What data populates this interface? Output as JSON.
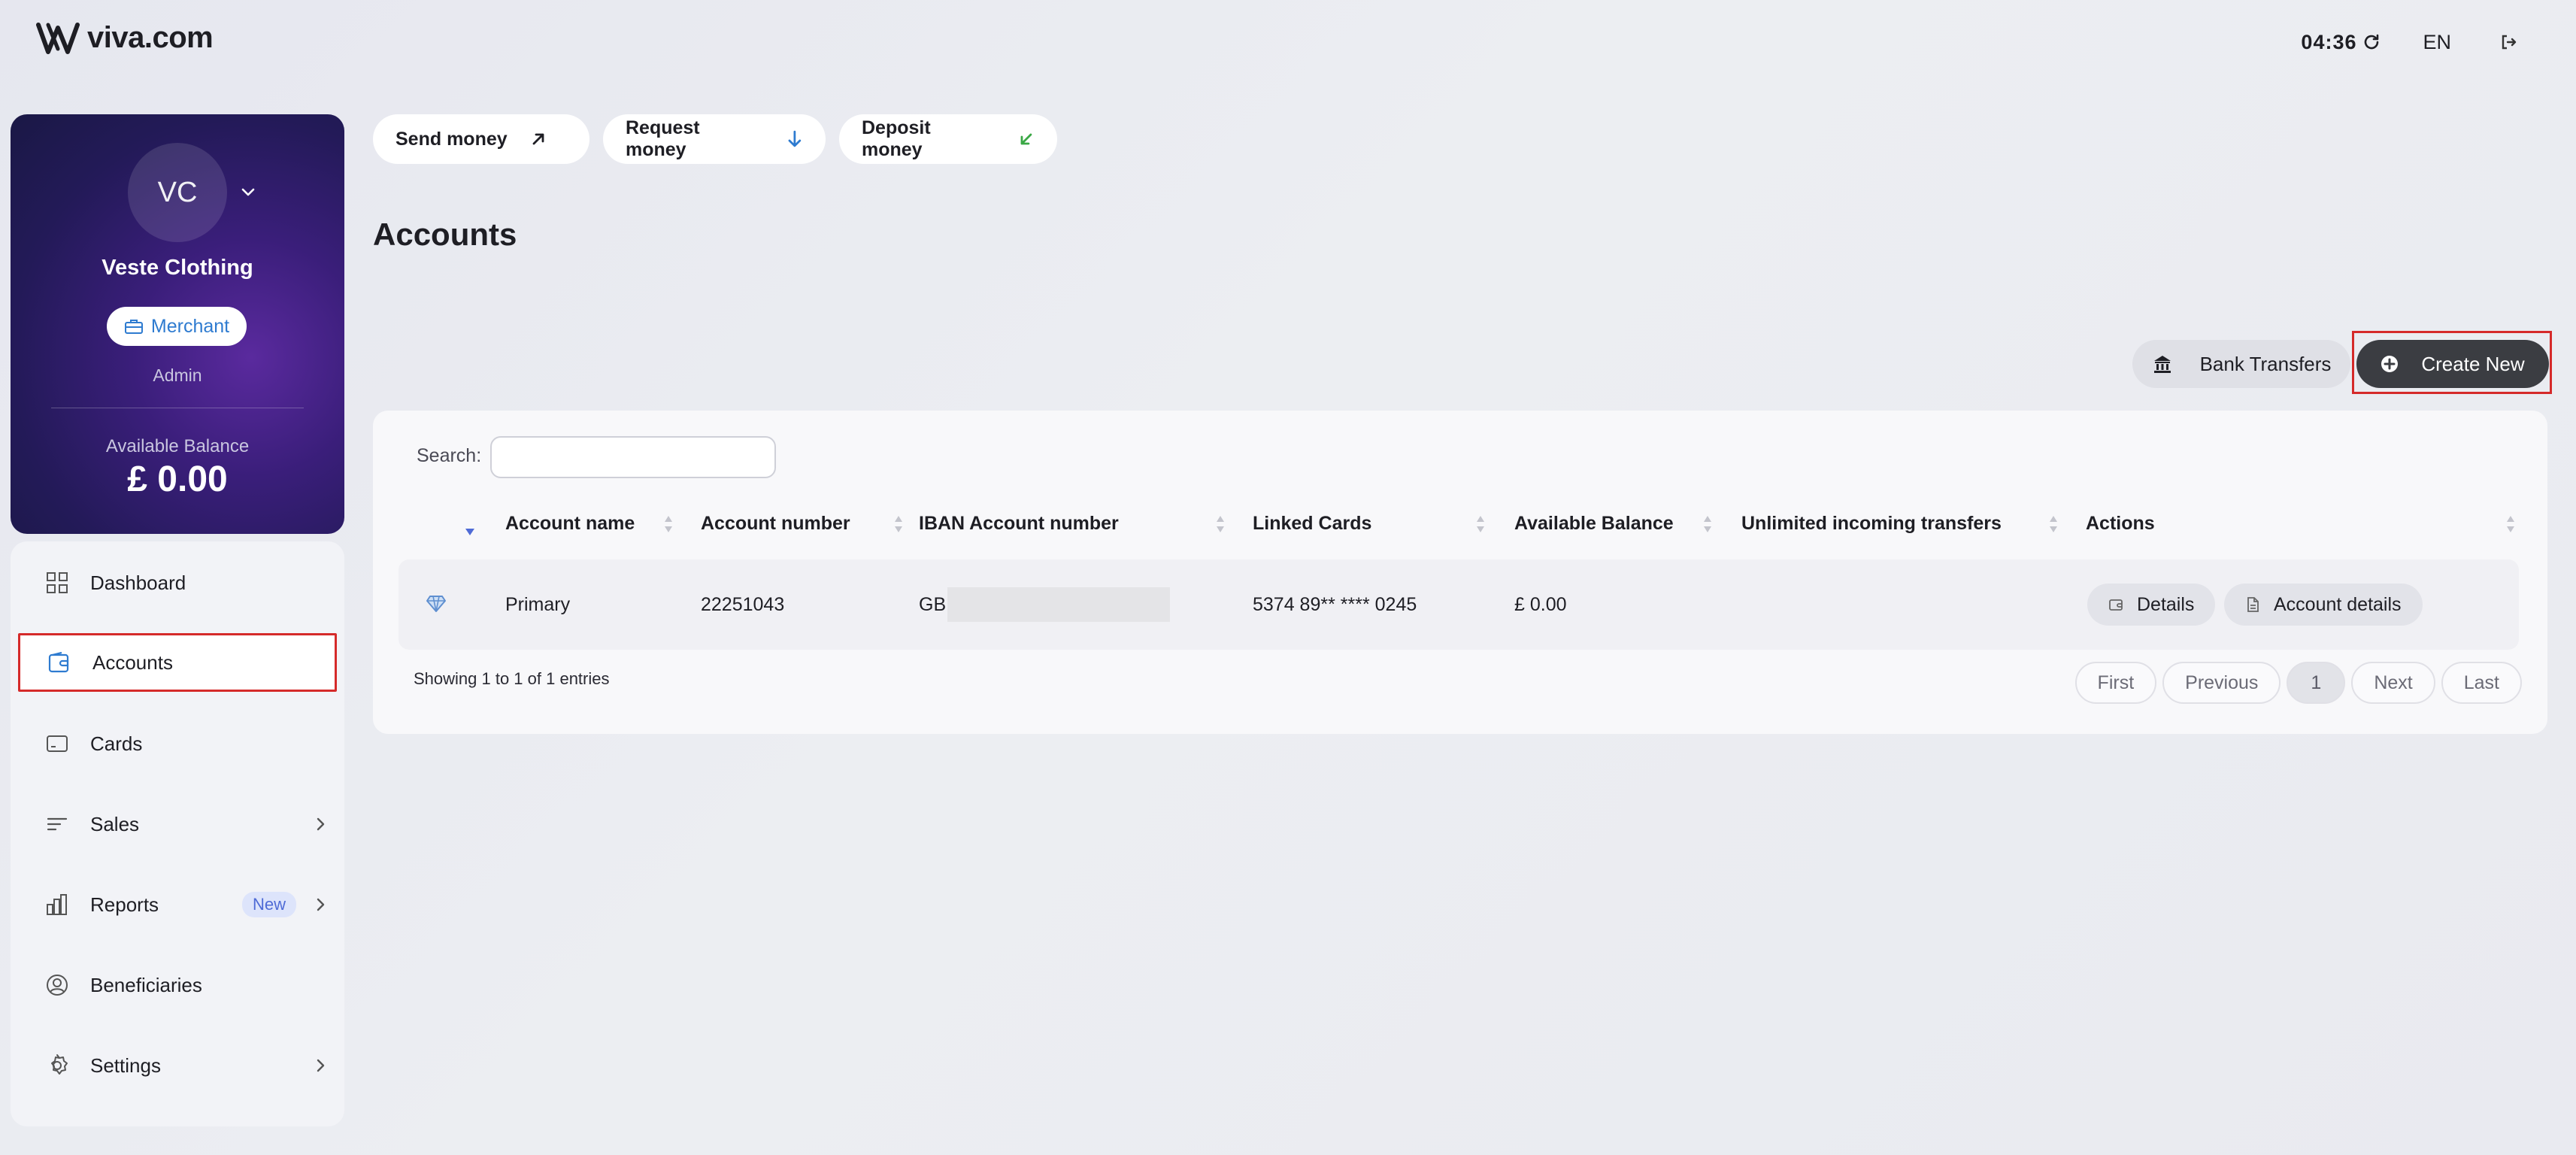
{
  "brand": {
    "logo_text": "viva.com"
  },
  "topbar": {
    "time": "04:36",
    "language": "EN"
  },
  "profile": {
    "initials": "VC",
    "company": "Veste Clothing",
    "badge": "Merchant",
    "role": "Admin",
    "balance_label": "Available Balance",
    "balance_value": "£ 0.00"
  },
  "sidebar": {
    "items": [
      {
        "label": "Dashboard",
        "icon": "grid-icon"
      },
      {
        "label": "Accounts",
        "icon": "wallet-icon",
        "active": true
      },
      {
        "label": "Cards",
        "icon": "card-icon"
      },
      {
        "label": "Sales",
        "icon": "lines-icon",
        "has_submenu": true
      },
      {
        "label": "Reports",
        "icon": "bar-chart-icon",
        "has_submenu": true,
        "badge": "New"
      },
      {
        "label": "Beneficiaries",
        "icon": "user-circle-icon"
      },
      {
        "label": "Settings",
        "icon": "gear-icon",
        "has_submenu": true
      }
    ]
  },
  "quick_actions": [
    {
      "label": "Send money",
      "icon": "arrow-up-right-icon",
      "color": "#1e1e24"
    },
    {
      "label": "Request money",
      "icon": "arrow-down-icon",
      "color": "#2e7bd0"
    },
    {
      "label": "Deposit money",
      "icon": "arrow-down-left-icon",
      "color": "#3aa845"
    }
  ],
  "page": {
    "title": "Accounts"
  },
  "toolbar": {
    "bank_transfers": "Bank Transfers",
    "create_new": "Create New"
  },
  "table": {
    "search_label": "Search:",
    "search_value": "",
    "columns": [
      "Account name",
      "Account number",
      "IBAN Account number",
      "Linked Cards",
      "Available Balance",
      "Unlimited incoming transfers",
      "Actions"
    ],
    "rows": [
      {
        "account_name": "Primary",
        "account_number": "22251043",
        "iban_prefix": "GB",
        "linked_cards": "5374 89** **** 0245",
        "available_balance": "£ 0.00",
        "unlimited_incoming": "",
        "actions": [
          "Details",
          "Account details"
        ]
      }
    ],
    "summary": "Showing 1 to 1 of 1 entries",
    "pagination": {
      "first": "First",
      "previous": "Previous",
      "current": "1",
      "next": "Next",
      "last": "Last"
    }
  },
  "colors": {
    "accent_blue": "#2e7bd0",
    "highlight_red": "#d52a2a",
    "dark_button": "#3b3d42",
    "success_green": "#3aa845"
  }
}
